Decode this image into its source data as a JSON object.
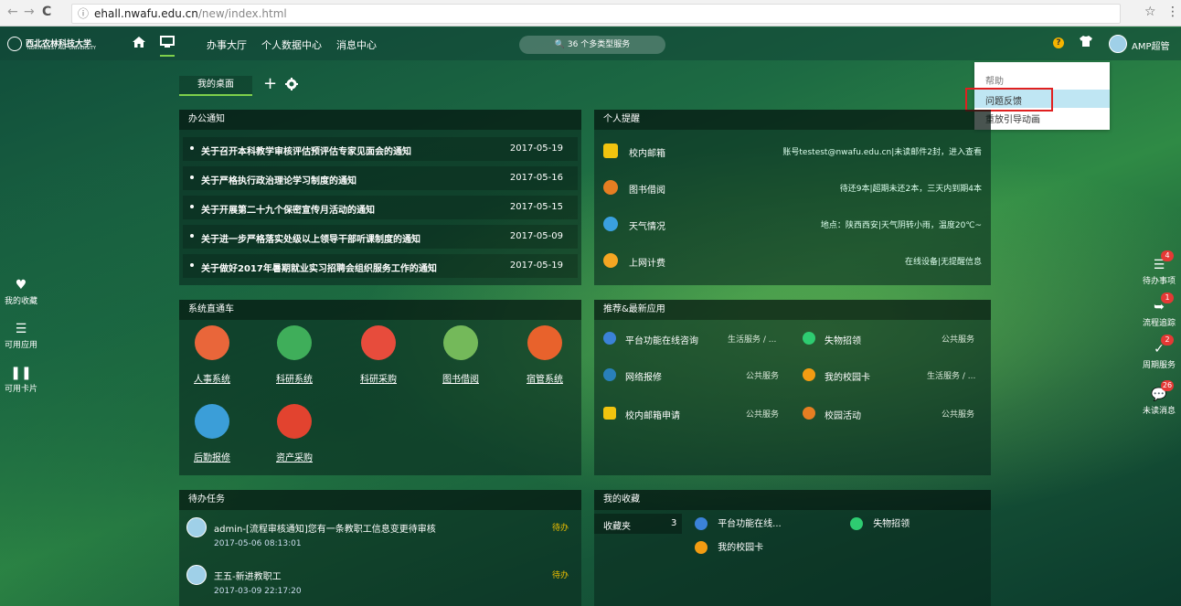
{
  "browser": {
    "back": "←",
    "forward": "→",
    "reload": "C",
    "info": "ⓘ",
    "url_host": "ehall.nwafu.edu.cn",
    "url_path": "/new/index.html",
    "star": "☆",
    "menu": "⋮"
  },
  "header": {
    "logo_cn": "西北农林科技大学",
    "logo_en": "NORTHWEST A&F UNIVERSITY",
    "nav": [
      "办事大厅",
      "个人数据中心",
      "消息中心"
    ],
    "search_label": "36 个多类型服务",
    "help_q": "?",
    "username": "AMP超管"
  },
  "dropdown": {
    "items": [
      "帮助",
      "问题反馈",
      "重放引导动画"
    ]
  },
  "desktop": {
    "tab_label": "我的桌面",
    "add": "+",
    "gear": "✿"
  },
  "notices": {
    "title": "办公通知",
    "rows": [
      {
        "title": "关于召开本科教学审核评估预评估专家见面会的通知",
        "date": "2017-05-19"
      },
      {
        "title": "关于严格执行政治理论学习制度的通知",
        "date": "2017-05-16"
      },
      {
        "title": "关于开展第二十九个保密宣传月活动的通知",
        "date": "2017-05-15"
      },
      {
        "title": "关于进一步严格落实处级以上领导干部听课制度的通知",
        "date": "2017-05-09"
      },
      {
        "title": "关于做好2017年暑期就业实习招聘会组织服务工作的通知",
        "date": "2017-05-19"
      }
    ]
  },
  "reminders": {
    "title": "个人提醒",
    "rows": [
      {
        "label": "校内邮箱",
        "info": "账号testest@nwafu.edu.cn|未读邮件2封，进入查看",
        "color": "#f1c40f"
      },
      {
        "label": "图书借阅",
        "info": "待还9本|超期未还2本，三天内到期4本",
        "color": "#e67e22"
      },
      {
        "label": "天气情况",
        "info": "地点：陕西西安|天气阴转小雨，温度20℃~",
        "color": "#3aa0e0"
      },
      {
        "label": "上网计费",
        "info": "在线设备|无提醒信息",
        "color": "#f5a623"
      }
    ]
  },
  "systems": {
    "title": "系统直通车",
    "items": [
      {
        "label": "人事系统",
        "color": "#e9663a"
      },
      {
        "label": "科研系统",
        "color": "#3fae5a"
      },
      {
        "label": "科研采购",
        "color": "#e74c3c"
      },
      {
        "label": "图书借阅",
        "color": "#74b95a"
      },
      {
        "label": "宿管系统",
        "color": "#e8622c"
      },
      {
        "label": "后勤报修",
        "color": "#3b9ed8"
      },
      {
        "label": "资产采购",
        "color": "#e2432f"
      }
    ]
  },
  "apps": {
    "title": "推荐&最新应用",
    "rows": [
      [
        {
          "name": "平台功能在线咨询",
          "cat": "生活服务 / ...",
          "color": "#3b82d8"
        },
        {
          "name": "失物招领",
          "cat": "公共服务",
          "color": "#2ecc71"
        }
      ],
      [
        {
          "name": "网络报修",
          "cat": "公共服务",
          "color": "#2980b9"
        },
        {
          "name": "我的校园卡",
          "cat": "生活服务 / ...",
          "color": "#f39c12"
        }
      ],
      [
        {
          "name": "校内邮箱申请",
          "cat": "公共服务",
          "color": "#f1c40f"
        },
        {
          "name": "校园活动",
          "cat": "公共服务",
          "color": "#e67e22"
        }
      ]
    ]
  },
  "tasks": {
    "title": "待办任务",
    "rows": [
      {
        "title": "admin-[流程审核通知]您有一条教职工信息变更待审核",
        "status": "待办",
        "date": "2017-05-06 08:13:01"
      },
      {
        "title": "王五-新进教职工",
        "status": "待办",
        "date": "2017-03-09 22:17:20"
      }
    ]
  },
  "favorites": {
    "title": "我的收藏",
    "folder_label": "收藏夹",
    "folder_count": "3",
    "items": [
      "平台功能在线...",
      "失物招领",
      "我的校园卡"
    ]
  },
  "left_sidebar": [
    "我的收藏",
    "可用应用",
    "可用卡片"
  ],
  "right_sidebar": [
    {
      "label": "待办事项",
      "badge": "4"
    },
    {
      "label": "流程追踪",
      "badge": "1"
    },
    {
      "label": "周期服务",
      "badge": "2"
    },
    {
      "label": "未读消息",
      "badge": "26"
    }
  ]
}
